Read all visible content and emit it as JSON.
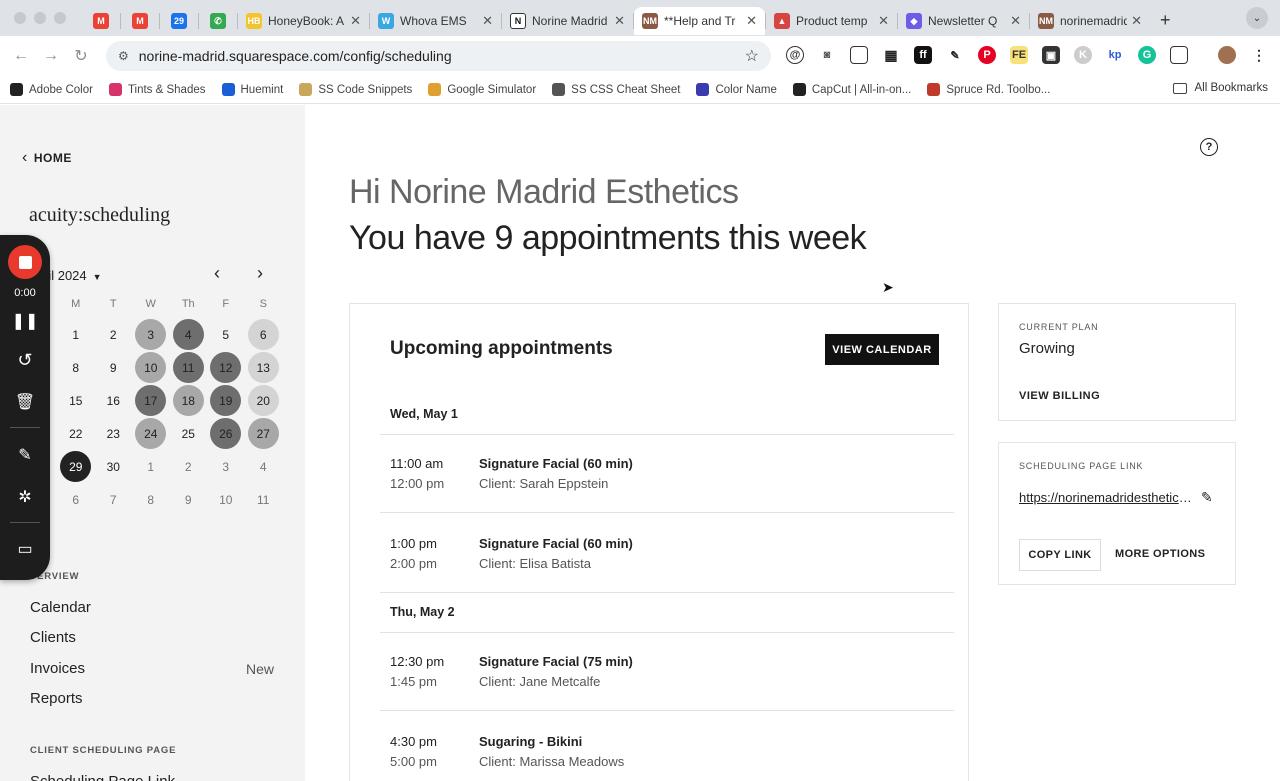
{
  "browser": {
    "tabs": [
      {
        "label": "",
        "icon": "gmail-icon",
        "color": "#ea4335",
        "glyph": "M"
      },
      {
        "label": "",
        "icon": "gmail-icon",
        "color": "#ea4335",
        "glyph": "M"
      },
      {
        "label": "",
        "icon": "google-calendar-icon",
        "color": "#1a73e8",
        "glyph": "29"
      },
      {
        "label": "",
        "icon": "phone-icon",
        "color": "#34a853",
        "glyph": "✆"
      },
      {
        "label": "HoneyBook: A",
        "icon": "honeybook-icon",
        "color": "#f4c430",
        "glyph": "HB"
      },
      {
        "label": "Whova EMS",
        "icon": "whova-icon",
        "color": "#3aa7e0",
        "glyph": "W"
      },
      {
        "label": "Norine Madrid",
        "icon": "notion-icon",
        "color": "#ffffff",
        "glyph": "N"
      },
      {
        "label": "**Help and Tr",
        "icon": "norine-icon",
        "color": "#8a5a44",
        "glyph": "NM"
      },
      {
        "label": "Product temp",
        "icon": "product-icon",
        "color": "#d64541",
        "glyph": "▲"
      },
      {
        "label": "Newsletter Q",
        "icon": "newsletter-icon",
        "color": "#6c5ce7",
        "glyph": "◆"
      },
      {
        "label": "norinemadrid",
        "icon": "norine-icon",
        "color": "#8a5a44",
        "glyph": "NM"
      }
    ],
    "url": "norine-madrid.squarespace.com/config/scheduling",
    "bookmarks": [
      {
        "label": "Adobe Color",
        "color": "#222222"
      },
      {
        "label": "Tints & Shades",
        "color": "#d6336c"
      },
      {
        "label": "Huemint",
        "color": "#1a5fd6"
      },
      {
        "label": "SS Code Snippets",
        "color": "#c9a75a"
      },
      {
        "label": "Google Simulator",
        "color": "#e0a02f"
      },
      {
        "label": "SS CSS Cheat Sheet",
        "color": "#555555"
      },
      {
        "label": "Color Name",
        "color": "#3b3bb0"
      },
      {
        "label": "CapCut | All-in-on...",
        "color": "#222222"
      },
      {
        "label": "Spruce Rd. Toolbo...",
        "color": "#c0392b"
      }
    ],
    "all_bookmarks": "All Bookmarks"
  },
  "sidebar": {
    "home": "HOME",
    "brand": "acuity:scheduling",
    "month": "ril 2024",
    "weekdays": [
      "M",
      "T",
      "W",
      "Th",
      "F",
      "S"
    ],
    "weeks": [
      [
        {
          "d": "1",
          "s": ""
        },
        {
          "d": "2",
          "s": ""
        },
        {
          "d": "3",
          "s": "mid"
        },
        {
          "d": "4",
          "s": "dark"
        },
        {
          "d": "5",
          "s": ""
        },
        {
          "d": "6",
          "s": "light"
        }
      ],
      [
        {
          "d": "8",
          "s": ""
        },
        {
          "d": "9",
          "s": ""
        },
        {
          "d": "10",
          "s": "mid"
        },
        {
          "d": "11",
          "s": "dark"
        },
        {
          "d": "12",
          "s": "dark"
        },
        {
          "d": "13",
          "s": "light"
        }
      ],
      [
        {
          "d": "15",
          "s": ""
        },
        {
          "d": "16",
          "s": ""
        },
        {
          "d": "17",
          "s": "dark"
        },
        {
          "d": "18",
          "s": "mid"
        },
        {
          "d": "19",
          "s": "dark"
        },
        {
          "d": "20",
          "s": "light"
        }
      ],
      [
        {
          "d": "22",
          "s": ""
        },
        {
          "d": "23",
          "s": ""
        },
        {
          "d": "24",
          "s": "mid"
        },
        {
          "d": "25",
          "s": ""
        },
        {
          "d": "26",
          "s": "dark"
        },
        {
          "d": "27",
          "s": "mid"
        }
      ],
      [
        {
          "d": "29",
          "s": "sel"
        },
        {
          "d": "30",
          "s": ""
        },
        {
          "d": "1",
          "s": "out"
        },
        {
          "d": "2",
          "s": "out"
        },
        {
          "d": "3",
          "s": "out"
        },
        {
          "d": "4",
          "s": "out"
        }
      ],
      [
        {
          "d": "6",
          "s": "out"
        },
        {
          "d": "7",
          "s": "out"
        },
        {
          "d": "8",
          "s": "out"
        },
        {
          "d": "9",
          "s": "out"
        },
        {
          "d": "10",
          "s": "out"
        },
        {
          "d": "11",
          "s": "out"
        }
      ]
    ],
    "overview_label": "VERVIEW",
    "nav": [
      "Calendar",
      "Clients",
      "Invoices",
      "Reports"
    ],
    "invoices_badge": "New",
    "client_page_label": "CLIENT SCHEDULING PAGE",
    "client_page_item": "Scheduling Page Link"
  },
  "recorder": {
    "time": "0:00"
  },
  "main": {
    "greeting": "Hi Norine Madrid Esthetics",
    "headline": "You have 9 appointments this week",
    "upcoming_title": "Upcoming appointments",
    "view_calendar": "VIEW CALENDAR",
    "days": [
      {
        "label": "Wed, May 1",
        "appointments": [
          {
            "start": "11:00 am",
            "end": "12:00 pm",
            "service": "Signature Facial (60 min)",
            "client": "Client: Sarah Eppstein"
          },
          {
            "start": "1:00 pm",
            "end": "2:00 pm",
            "service": "Signature Facial (60 min)",
            "client": "Client: Elisa Batista"
          }
        ]
      },
      {
        "label": "Thu, May 2",
        "appointments": [
          {
            "start": "12:30 pm",
            "end": "1:45 pm",
            "service": "Signature Facial (75 min)",
            "client": "Client: Jane Metcalfe"
          },
          {
            "start": "4:30 pm",
            "end": "5:00 pm",
            "service": "Sugaring - Bikini",
            "client": "Client: Marissa Meadows"
          }
        ]
      }
    ],
    "plan": {
      "label": "CURRENT PLAN",
      "name": "Growing",
      "billing": "VIEW BILLING"
    },
    "link_card": {
      "label": "SCHEDULING PAGE LINK",
      "url": "https://norinemadridesthetics.as.me/",
      "copy": "COPY LINK",
      "more": "MORE OPTIONS"
    }
  }
}
